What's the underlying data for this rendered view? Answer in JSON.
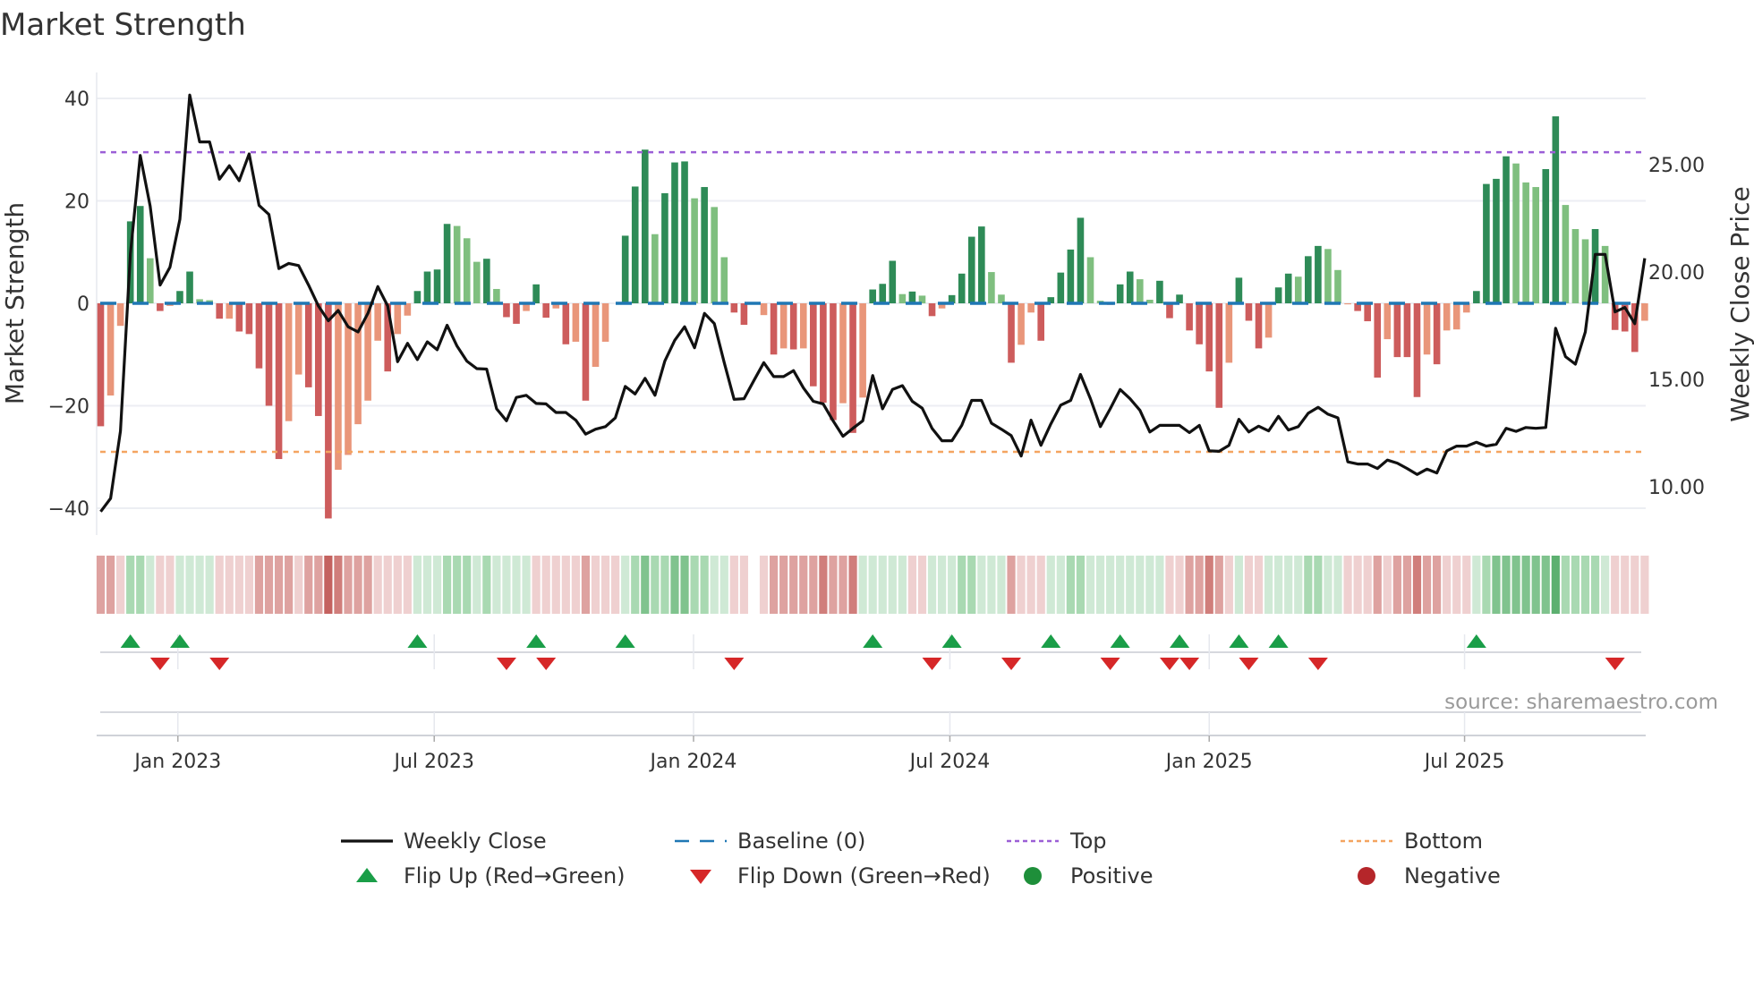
{
  "chart_data": {
    "type": "bar",
    "title": "Market Strength",
    "ylabel": "Market Strength",
    "y2label": "Weekly Close Price",
    "ylim": [
      -45,
      45
    ],
    "y2lim": [
      8.3,
      27.8
    ],
    "yticks": [
      {
        "v": 40,
        "label": "40"
      },
      {
        "v": 20,
        "label": "20"
      },
      {
        "v": 0,
        "label": "0"
      },
      {
        "v": -20,
        "label": "−20"
      },
      {
        "v": -40,
        "label": "−40"
      }
    ],
    "y2ticks": [
      {
        "v": 25,
        "label": "25.00"
      },
      {
        "v": 20,
        "label": "20.00"
      },
      {
        "v": 15,
        "label": "15.00"
      },
      {
        "v": 10,
        "label": "10.00"
      }
    ],
    "xticks": [
      {
        "week": 7.8,
        "label": "Jan 2023"
      },
      {
        "week": 33.7,
        "label": "Jul 2023"
      },
      {
        "week": 59.9,
        "label": "Jan 2024"
      },
      {
        "week": 85.8,
        "label": "Jul 2024"
      },
      {
        "week": 112.0,
        "label": "Jan 2025"
      },
      {
        "week": 137.8,
        "label": "Jul 2025"
      }
    ],
    "grid": true,
    "top_level": 29.5,
    "bottom_level": -29,
    "baseline": 0,
    "strength": [
      -24,
      -18,
      -4.4,
      16,
      19,
      8.8,
      -1.5,
      -0.5,
      2.4,
      6.2,
      0.8,
      0.6,
      -3,
      -3,
      -5.5,
      -6,
      -12.7,
      -20,
      -30.4,
      -23,
      -13.9,
      -16.4,
      -22,
      -42,
      -32.5,
      -29.6,
      -23.6,
      -19,
      -7.3,
      -13.3,
      -6,
      -2.4,
      2.4,
      6.2,
      6.6,
      15.5,
      15.1,
      12.7,
      8.1,
      8.7,
      2.8,
      -2.7,
      -4,
      -1.5,
      3.7,
      -2.8,
      -1,
      -8,
      -7.5,
      -19,
      -12.4,
      -7.5,
      0,
      13.2,
      22.8,
      30,
      13.5,
      21.5,
      27.5,
      27.7,
      20.5,
      22.7,
      18.8,
      9,
      -1.8,
      -4.2,
      0,
      -2.3,
      -10,
      -8.8,
      -9,
      -8.8,
      -16.2,
      -19.4,
      -22.8,
      -19.5,
      -25.3,
      -18.4,
      2.7,
      3.8,
      8.3,
      1.8,
      2.3,
      1.5,
      -2.5,
      -1,
      1.6,
      5.8,
      13,
      15,
      6.1,
      1.7,
      -11.6,
      -8.1,
      -1.8,
      -7.3,
      1.2,
      6,
      10.5,
      16.7,
      9,
      0.5,
      -0.3,
      3.7,
      6.2,
      4.7,
      0.7,
      4.4,
      -2.9,
      1.7,
      -5.3,
      -8,
      -13.3,
      -20.4,
      -11.6,
      5,
      -3.4,
      -8.8,
      -6.7,
      3.1,
      5.8,
      5.2,
      9.2,
      11.2,
      10.6,
      6.5,
      -0.2,
      -1.5,
      -3.5,
      -14.5,
      -7,
      -10.5,
      -10.5,
      -18.3,
      -10,
      -11.9,
      -5.3,
      -5.1,
      -1.8,
      2.4,
      23.3,
      24.3,
      28.7,
      27.3,
      23.6,
      22.7,
      26.2,
      36.5,
      19.2,
      14.5,
      12.5,
      14.5,
      11.2,
      -5.2,
      -5.5,
      -9.5,
      -3.4
    ],
    "strength_shade": "RrrGGgRrGGggRrRRRRRrrRRRrrrrrRrrGGGGgggGgRRrGRrRrRrr_GGGgGGGgGggRR_rRrRrRRRrRrGGGgGgRrGGGGggRrrRGGGGggRGGggGRGRRRRrGRRrGGgGGggrRRRrRRRrRrrrGGGGgggGGgggGgRRRr",
    "weekly_close": [
      8.84,
      9.46,
      12.59,
      20.85,
      25.43,
      23.07,
      19.39,
      20.22,
      22.45,
      28.24,
      26.06,
      26.06,
      24.32,
      24.95,
      24.25,
      25.5,
      23.1,
      22.68,
      20.16,
      20.4,
      20.3,
      19.39,
      18.42,
      17.73,
      18.21,
      17.45,
      17.21,
      18.07,
      19.32,
      18.42,
      15.82,
      16.68,
      15.92,
      16.75,
      16.38,
      17.52,
      16.55,
      15.85,
      15.5,
      15.48,
      13.63,
      13.07,
      14.16,
      14.26,
      13.88,
      13.86,
      13.46,
      13.46,
      13.1,
      12.45,
      12.68,
      12.8,
      13.21,
      14.67,
      14.32,
      15.05,
      14.26,
      15.85,
      16.82,
      17.45,
      16.47,
      18.07,
      17.6,
      15.78,
      14.07,
      14.1,
      14.95,
      15.78,
      15.13,
      15.13,
      15.41,
      14.6,
      13.98,
      13.86,
      13.07,
      12.35,
      12.72,
      13.07,
      15.18,
      13.63,
      14.53,
      14.71,
      13.98,
      13.66,
      12.72,
      12.14,
      12.14,
      12.86,
      14.02,
      14.02,
      12.96,
      12.68,
      12.38,
      11.43,
      13.1,
      11.93,
      12.93,
      13.8,
      14.02,
      15.23,
      14.1,
      12.8,
      13.63,
      14.53,
      14.1,
      13.56,
      12.55,
      12.86,
      12.86,
      12.86,
      12.52,
      12.86,
      11.67,
      11.65,
      11.93,
      13.14,
      12.55,
      12.82,
      12.6,
      13.28,
      12.64,
      12.8,
      13.42,
      13.7,
      13.38,
      13.21,
      11.16,
      11.06,
      11.06,
      10.85,
      11.24,
      11.1,
      10.85,
      10.57,
      10.82,
      10.64,
      11.67,
      11.89,
      11.89,
      12.07,
      11.89,
      11.98,
      12.72,
      12.58,
      12.76,
      12.72,
      12.76,
      17.38,
      16.06,
      15.71,
      17.21,
      20.82,
      20.82,
      18.14,
      18.35,
      17.59,
      20.64
    ],
    "regime_strip": [
      -2,
      -2,
      -1,
      2,
      2,
      1,
      -1,
      -1,
      1,
      1,
      1,
      1,
      -1,
      -1,
      -1,
      -1,
      -2,
      -2,
      -2,
      -2,
      -1,
      -2,
      -2,
      -4,
      -3,
      -2,
      -2,
      -2,
      -1,
      -1,
      -1,
      -1,
      1,
      1,
      1,
      2,
      2,
      2,
      1,
      2,
      1,
      1,
      1,
      1,
      -1,
      -1,
      -1,
      -1,
      -1,
      -2,
      -1,
      -1,
      -1,
      1,
      2,
      3,
      2,
      2,
      3,
      3,
      2,
      2,
      1,
      1,
      -1,
      -1,
      0,
      -1,
      -2,
      -2,
      -2,
      -2,
      -2,
      -3,
      -2,
      -2,
      -3,
      1,
      1,
      1,
      1,
      1,
      -1,
      -1,
      1,
      1,
      1,
      2,
      2,
      1,
      1,
      1,
      -2,
      -1,
      -1,
      -1,
      1,
      1,
      2,
      2,
      1,
      1,
      1,
      1,
      1,
      1,
      1,
      1,
      -1,
      -1,
      -2,
      -2,
      -3,
      -2,
      -1,
      1,
      -1,
      -1,
      1,
      1,
      1,
      1,
      2,
      2,
      1,
      1,
      -1,
      -1,
      -1,
      -2,
      -1,
      -2,
      -2,
      -3,
      -2,
      -2,
      -1,
      -1,
      -1,
      1,
      2,
      3,
      3,
      3,
      3,
      3,
      3,
      4,
      2,
      2,
      2,
      2,
      1,
      -1,
      -1,
      -1,
      -1
    ],
    "flip_up_weeks": [
      3,
      8,
      32,
      44,
      53,
      78,
      86,
      96,
      103,
      109,
      115,
      119,
      139
    ],
    "flip_down_weeks": [
      6,
      12,
      41,
      45,
      64,
      84,
      92,
      102,
      108,
      110,
      116,
      123,
      153
    ],
    "legend_placement": "bottom",
    "legend": [
      {
        "key": "close",
        "label": "Weekly Close"
      },
      {
        "key": "baseline",
        "label": "Baseline (0)"
      },
      {
        "key": "top",
        "label": "Top"
      },
      {
        "key": "bottom",
        "label": "Bottom"
      },
      {
        "key": "flipup",
        "label": "Flip Up (Red→Green)"
      },
      {
        "key": "flipdown",
        "label": "Flip Down (Green→Red)"
      },
      {
        "key": "positive",
        "label": "Positive"
      },
      {
        "key": "negative",
        "label": "Negative"
      }
    ]
  },
  "source": "source: sharemaestro.com",
  "colors": {
    "pos_dark": "#2e8b57",
    "pos_light": "#7fbf7f",
    "neg_dark": "#cd5c5c",
    "neg_light": "#e9967a",
    "baseline": "#1f77b4",
    "top": "#9b5fd6",
    "bottom": "#f4a460",
    "close": "#111111",
    "flip_up": "#1a9e48",
    "flip_down": "#d62728",
    "positive": "#1e8f3a",
    "negative": "#b5262a",
    "strip_neg": [
      "#efd0d0",
      "#dea2a0",
      "#d07e7b",
      "#c4625f"
    ],
    "strip_pos": [
      "#cfe9d5",
      "#a9d9b2",
      "#80c38e",
      "#5db070"
    ]
  }
}
